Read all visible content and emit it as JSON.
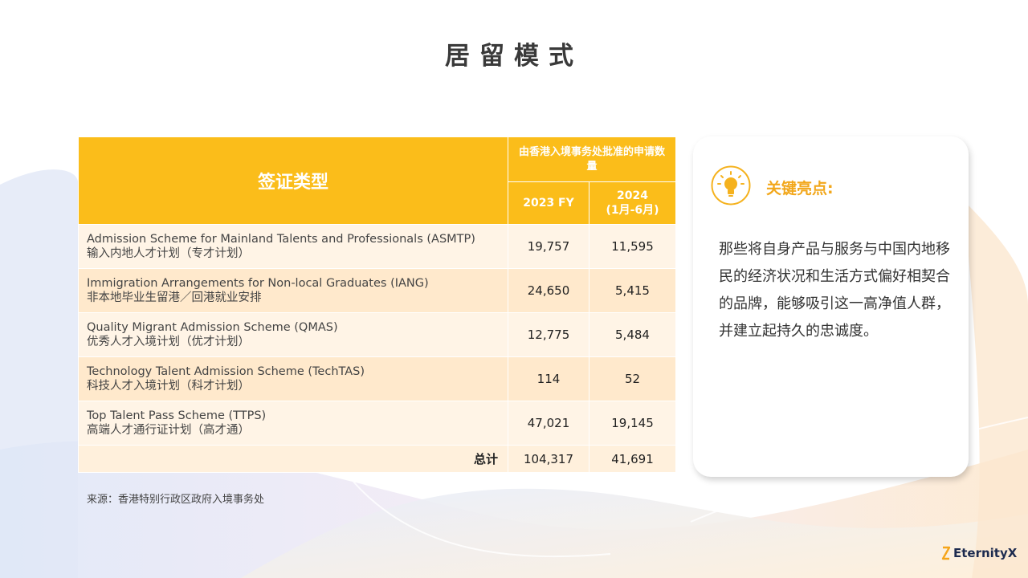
{
  "title": "居留模式",
  "table": {
    "header_type": "签证类型",
    "header_group": "由香港入境事务处批准的申请数量",
    "header_2023": "2023 FY",
    "header_2024": "2024\n(1月-6月)",
    "rows": [
      {
        "en": "Admission Scheme for Mainland Talents and Professionals (ASMTP)",
        "zh": "输入内地人才计划（专才计划）",
        "v2023": "19,757",
        "v2024": "11,595"
      },
      {
        "en": "Immigration Arrangements for Non-local Graduates (IANG)",
        "zh": "非本地毕业生留港／回港就业安排",
        "v2023": "24,650",
        "v2024": "5,415"
      },
      {
        "en": "Quality Migrant Admission Scheme (QMAS)",
        "zh": "优秀人才入境计划（优才计划）",
        "v2023": "12,775",
        "v2024": "5,484"
      },
      {
        "en": "Technology Talent Admission Scheme (TechTAS)",
        "zh": "科技人才入境计划（科才计划）",
        "v2023": "114",
        "v2024": "52"
      },
      {
        "en": "Top Talent Pass Scheme (TTPS)",
        "zh": "高端人才通行证计划（高才通）",
        "v2023": "47,021",
        "v2024": "19,145"
      }
    ],
    "total_label": "总计",
    "total_2023": "104,317",
    "total_2024": "41,691"
  },
  "source": "来源：香港特别行政区政府入境事务处",
  "card": {
    "heading": "关键亮点:",
    "body": "那些将自身产品与服务与中国内地移民的经济状况和生活方式偏好相契合的品牌，能够吸引这一高净值人群，并建立起持久的忠诚度。",
    "icon": "lightbulb-icon"
  },
  "logo": {
    "text": "EternityX"
  },
  "colors": {
    "accent": "#fbbd1a",
    "highlight": "#f2a71b",
    "row_light": "#fff4e6",
    "row_dark": "#ffe9cc"
  }
}
